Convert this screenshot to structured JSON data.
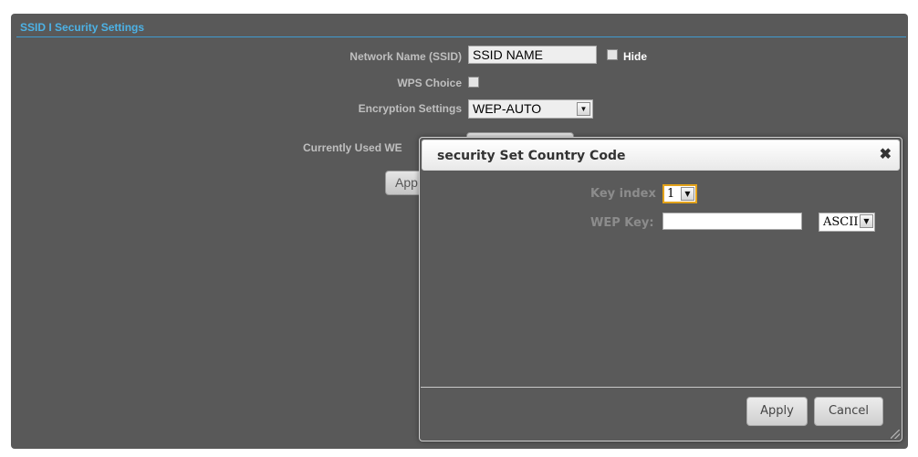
{
  "section": {
    "title": "SSID I Security Settings"
  },
  "form": {
    "network_name_label": "Network Name (SSID)",
    "network_name_value": "SSID NAME",
    "hide_label": "Hide",
    "wps_label": "WPS Choice",
    "encryption_label": "Encryption Settings",
    "encryption_value": "WEP-AUTO",
    "currently_used_label": "Currently Used WE",
    "apply_partial_label": "App"
  },
  "dialog": {
    "title": "security Set Country Code",
    "close_glyph": "✖",
    "key_index_label": "Key index",
    "key_index_value": "1",
    "wep_key_label": "WEP Key:",
    "wep_key_value": "",
    "key_format_value": "ASCII",
    "apply_label": "Apply",
    "cancel_label": "Cancel"
  },
  "icons": {
    "dropdown": "chevron-down-icon",
    "close": "close-icon",
    "resize": "resize-grip-icon"
  },
  "colors": {
    "panel_bg": "#595959",
    "section_title": "#4cb2e6",
    "focus_border": "#e3a21a"
  }
}
